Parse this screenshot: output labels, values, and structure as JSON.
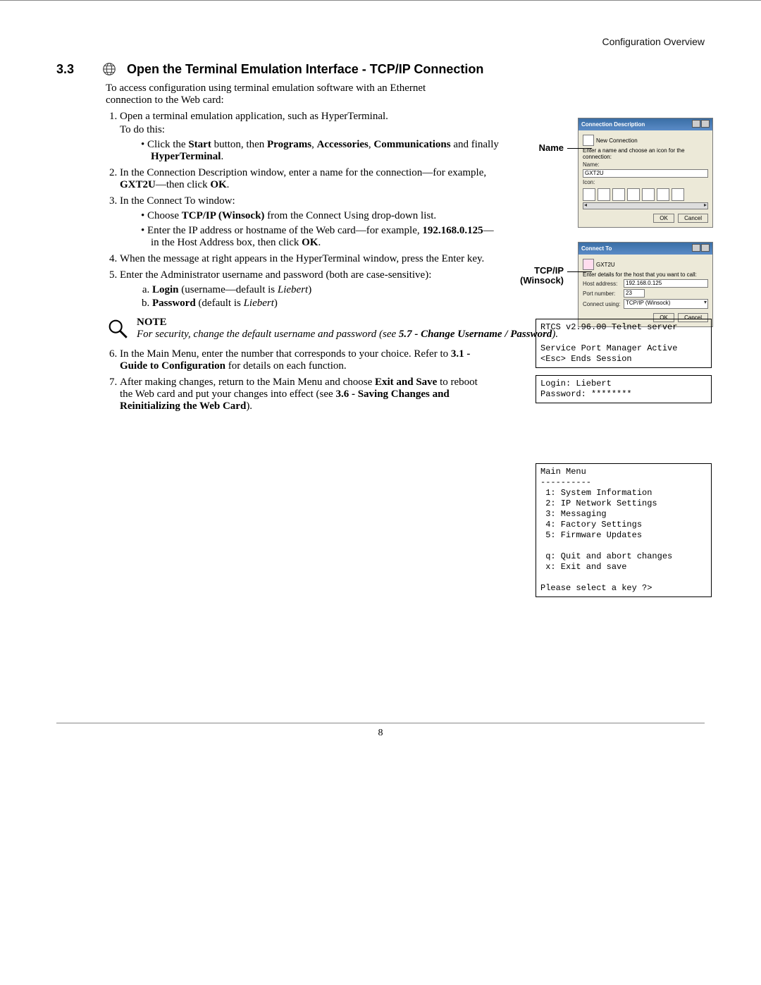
{
  "header": {
    "right": "Configuration Overview"
  },
  "section": {
    "number": "3.3",
    "title": "Open the Terminal Emulation Interface - TCP/IP Connection"
  },
  "intro": "To access configuration using terminal emulation software with an Ethernet connection to the Web card:",
  "labels": {
    "name": "Name",
    "tcpip": "TCP/IP",
    "winsock": "(Winsock)"
  },
  "steps": {
    "s1_a": "Open a terminal emulation application, such as HyperTerminal.",
    "s1_b": "To do this:",
    "s1_bullet_pre": "Click the ",
    "s1_bullet_start": "Start",
    "s1_bullet_mid1": " button, then ",
    "s1_bullet_programs": "Programs",
    "s1_bullet_comma1": ", ",
    "s1_bullet_accessories": "Accessories",
    "s1_bullet_comma2": ", ",
    "s1_bullet_comm": "Communications",
    "s1_bullet_and": " and finally ",
    "s1_bullet_hyper": "HyperTerminal",
    "s1_bullet_end": ".",
    "s2_a": "In the Connection Description window, enter a name for the connection—for example, ",
    "s2_gxt": "GXT2U",
    "s2_b": "—then click ",
    "s2_ok": "OK",
    "s2_end": ".",
    "s3_a": "In the Connect To window:",
    "s3_b1_a": "Choose ",
    "s3_b1_tcp": "TCP/IP (Winsock)",
    "s3_b1_b": " from the Connect Using drop-down list.",
    "s3_b2_a": "Enter the IP address or hostname of the Web card—for example, ",
    "s3_b2_ip": "192.168.0.125",
    "s3_b2_b": "—in the Host Address box, then click ",
    "s3_b2_ok": "OK",
    "s3_b2_end": ".",
    "s4": "When the message at right appears in the HyperTerminal window, press the Enter key.",
    "s5": "Enter the Administrator username and password (both are case-sensitive):",
    "s5a_a": "Login",
    "s5a_b": " (username—default is ",
    "s5a_c": "Liebert",
    "s5a_d": ")",
    "s5b_a": "Password",
    "s5b_b": " (default is ",
    "s5b_c": "Liebert",
    "s5b_d": ")",
    "s6_a": "In the Main Menu, enter the number that corresponds to your choice. Refer to ",
    "s6_link": "3.1 - Guide to Configuration",
    "s6_b": " for details on each function.",
    "s7_a": "After making changes, return to the Main Menu and choose ",
    "s7_exit": "Exit and Save",
    "s7_b": " to reboot the Web card and put your changes into effect (see ",
    "s7_link": "3.6 - Saving Changes and Reinitializing the Web Card",
    "s7_c": ")."
  },
  "note": {
    "head": "NOTE",
    "text_a": "For security, change the default username and password (see ",
    "text_link": "5.7 - Change Username / Password",
    "text_b": ")."
  },
  "dialog1": {
    "title": "Connection Description",
    "new_conn": "New Connection",
    "prompt": "Enter a name and choose an icon for the connection:",
    "name_label": "Name:",
    "name_val": "GXT2U",
    "icon_label": "Icon:",
    "ok": "OK",
    "cancel": "Cancel"
  },
  "dialog2": {
    "title": "Connect To",
    "host": "GXT2U",
    "prompt": "Enter details for the host that you want to call:",
    "host_label": "Host address:",
    "host_val": "192.168.0.125",
    "port_label": "Port number:",
    "port_val": "23",
    "conn_label": "Connect using:",
    "conn_val": "TCP/IP (Winsock)",
    "ok": "OK",
    "cancel": "Cancel"
  },
  "term1": "RTCS v2.96.00 Telnet server\n\nService Port Manager Active\n<Esc> Ends Session",
  "term2": "Login: Liebert\nPassword: ********",
  "term3": "Main Menu\n----------\n 1: System Information\n 2: IP Network Settings\n 3: Messaging\n 4: Factory Settings\n 5: Firmware Updates\n\n q: Quit and abort changes\n x: Exit and save\n\nPlease select a key ?>",
  "footer": {
    "page": "8"
  }
}
